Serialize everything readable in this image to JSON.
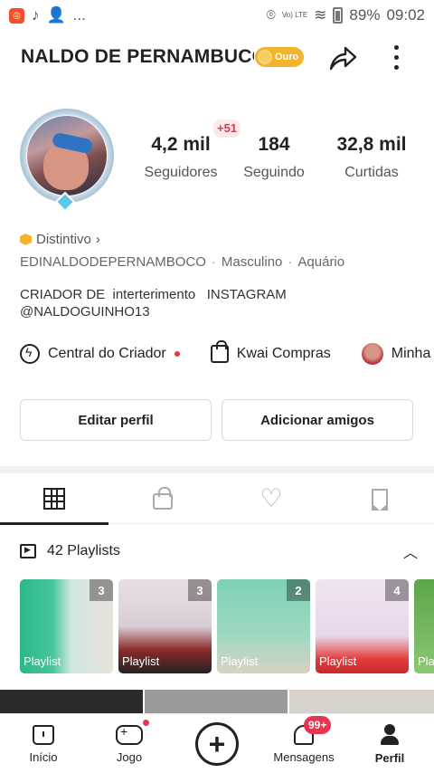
{
  "status_bar": {
    "left_icons": [
      "kwai-app-icon",
      "tiktok-icon",
      "person-add-icon"
    ],
    "ellipsis": "...",
    "lte_label": "Vo) LTE",
    "battery": "89%",
    "time": "09:02"
  },
  "header": {
    "name": "NALDO DE PERNAMBUCO",
    "badge": "Ouro"
  },
  "profile": {
    "followers_value": "4,2 mil",
    "followers_label": "Seguidores",
    "followers_delta": "+51",
    "following_value": "184",
    "following_label": "Seguindo",
    "likes_value": "32,8 mil",
    "likes_label": "Curtidas",
    "distintivo": "Distintivo",
    "username": "EDINALDODEPERNAMBOCO",
    "gender": "Masculino",
    "sign": "Aquário",
    "bio_line1": "CRIADOR DE  interterimento   INSTAGRAM",
    "bio_line2": "@NALDOGUINHO13"
  },
  "quick_links": {
    "creator_center": "Central do Criador",
    "shopping": "Kwai Compras",
    "mine": "Minha"
  },
  "buttons": {
    "edit_profile": "Editar perfil",
    "add_friends": "Adicionar amigos"
  },
  "tabs": [
    "grid-icon",
    "lock-icon",
    "heart-icon",
    "bookmark-icon"
  ],
  "playlists": {
    "title": "42 Playlists",
    "items": [
      {
        "label": "Playlist",
        "count": "3"
      },
      {
        "label": "Playlist",
        "count": "3"
      },
      {
        "label": "Playlist",
        "count": "2"
      },
      {
        "label": "Playlist",
        "count": "4"
      },
      {
        "label": "Pla",
        "count": ""
      }
    ]
  },
  "bottom_nav": {
    "home": "Início",
    "game": "Jogo",
    "messages": "Mensagens",
    "messages_badge": "99+",
    "profile": "Perfil"
  },
  "colors": {
    "accent_red": "#e8344e",
    "gold": "#f3b32c"
  }
}
